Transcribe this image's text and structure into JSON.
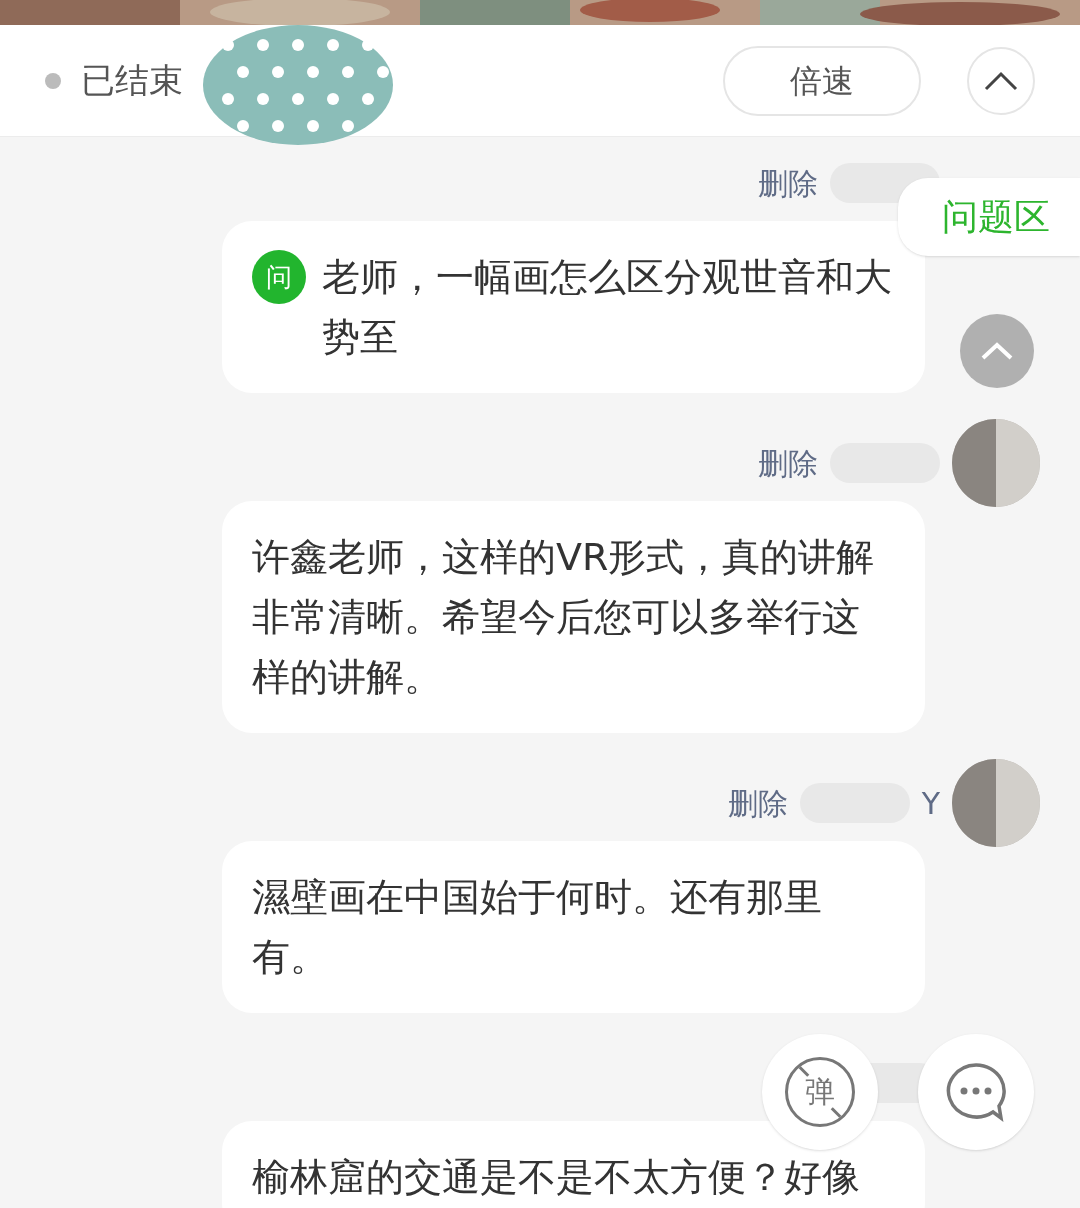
{
  "header": {
    "status": "已结束",
    "ended": true,
    "speed_button": "倍速",
    "collapse": {
      "expanded": true
    }
  },
  "messages": [
    {
      "delete": "删除",
      "question": true,
      "badge": "问",
      "text": "老师，一幅画怎么区分观世音和大势至"
    },
    {
      "delete": "删除",
      "question": false,
      "text": "许鑫老师，这样的VR形式，真的讲解非常清晰。希望今后您可以多举行这样的讲解。"
    },
    {
      "delete": "删除",
      "name": "Y",
      "question": false,
      "text": "濕壁画在中国始于何时。还有那里有。"
    },
    {
      "question": false,
      "text": "榆林窟的交通是不是不太方便？好像"
    }
  ],
  "question_tab": "问题区",
  "danmaku_button": {
    "glyph": "弹",
    "off": true
  }
}
